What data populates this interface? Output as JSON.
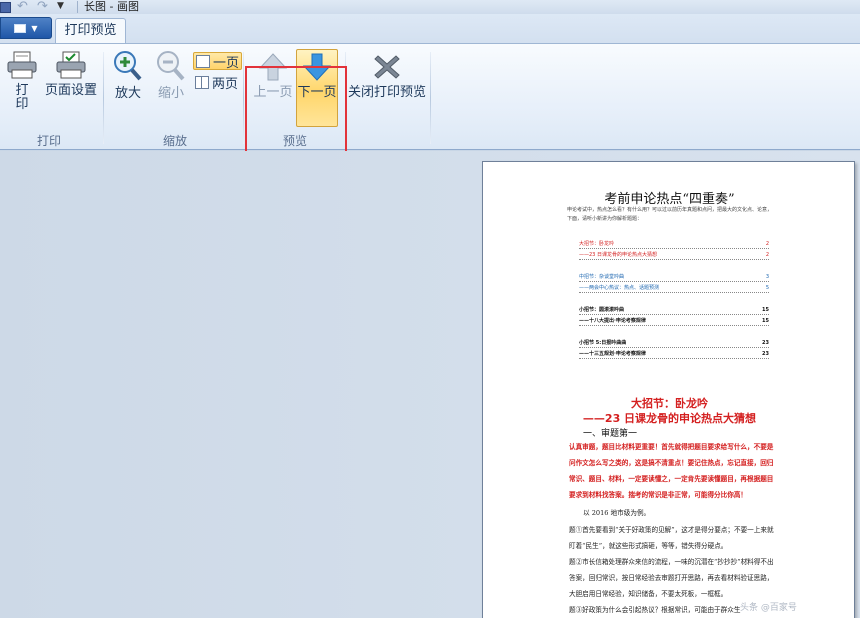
{
  "window": {
    "title": "长图 - 画图"
  },
  "tabs": [
    {
      "label": "打印预览"
    }
  ],
  "ribbon": {
    "groups": {
      "print": {
        "label": "打印",
        "buttons": {
          "print": "打\n印",
          "page_setup": "页面设置"
        }
      },
      "zoom": {
        "label": "缩放",
        "buttons": {
          "zoom_in": "放大",
          "zoom_out": "缩小",
          "one_page": "一页",
          "two_page": "两页"
        }
      },
      "preview": {
        "label": "预览",
        "buttons": {
          "prev_page": "上一页",
          "next_page": "下一页"
        }
      },
      "close": {
        "buttons": {
          "close_preview": "关闭打印预览"
        }
      }
    }
  },
  "document": {
    "title": "考前申论热点“四重奏”",
    "intro": "申论考试中，热点怎么看？有什么用？可以过以前历年真题和点问，把最大的文化点、论意，下面，请听小新讲为你解析题题：",
    "toc": [
      {
        "text": "大招节：卧龙吟",
        "page": "2",
        "style": "red"
      },
      {
        "text": "——23 日课龙骨的申论热点大猜想",
        "page": "2",
        "style": "red"
      },
      {
        "text": "中招节：杂谈堂吟曲",
        "page": "3",
        "style": "blue"
      },
      {
        "text": "——两会中心热议：热点、话题预测",
        "page": "5",
        "style": "blue"
      },
      {
        "text": "小招节：圆滚滚吟曲",
        "page": "15",
        "style": "blk"
      },
      {
        "text": "——十八大提出·申论考察规律",
        "page": "15",
        "style": "blk"
      },
      {
        "text": "小招节 5:日报吟曲曲",
        "page": "23",
        "style": "blk"
      },
      {
        "text": "——十三五规划·申论考察规律",
        "page": "23",
        "style": "blk"
      }
    ],
    "heading1": "大招节：卧龙吟",
    "heading2": "——23 日课龙骨的申论热点大猜想",
    "section": "一、审题第一",
    "bold_paragraph": "认真审题，题目比材料更重要！首先就得把题目要求给写什么，不要是问作文怎么写之类的，这是搞不清重点！要记住热点，忘记直接，回归常识、题目、材料，一定要读懂之，一定肯先要读懂题目，再根据题目要求到材料找答案。揣考的常识是非正常，可能得分比你高！",
    "paragraphs": [
      "以 2016 地市级为例。",
      "题①首先要看到“关于好政策的见解”，这才是得分要点；不要一上来就盯着“民生”，就这些形式搞砸，等等，错失得分硬点。",
      "题②市长信箱处理群众来信的流程，一味的沉潜在“抄抄抄”材料得不出答案，回归常识，按日常经验去审题打开思路，再去看材料验证思路，大胆启用日常经验，知识储备，不要太死板，一框框。",
      "题③好政策为什么会引起热议？根据常识，可能由于群众生"
    ],
    "watermark": "头条 @百家号"
  }
}
